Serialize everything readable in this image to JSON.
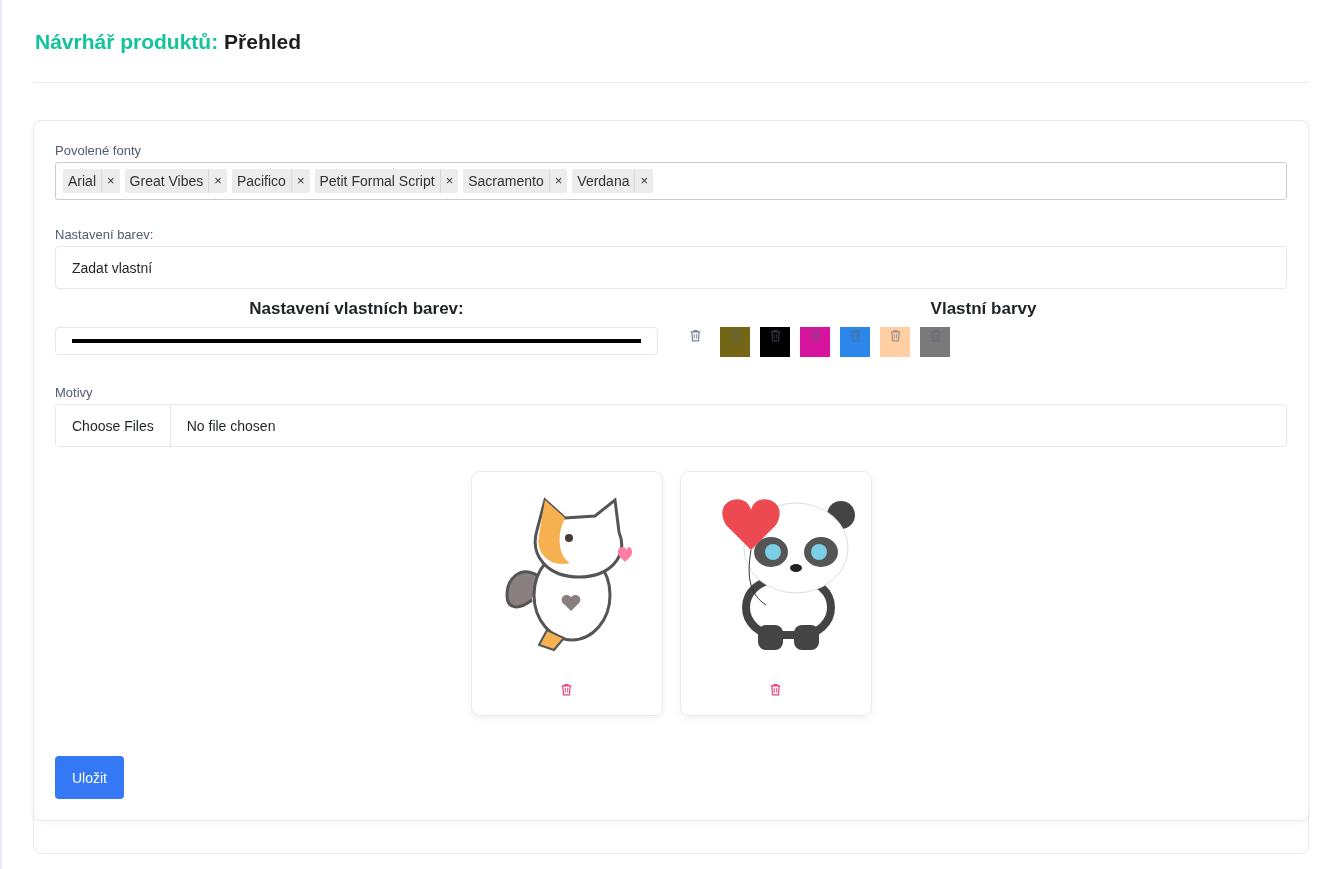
{
  "header": {
    "title_prefix": "Návrhář produktů:",
    "title": "Přehled"
  },
  "fonts": {
    "label": "Povolené fonty",
    "tags": [
      {
        "label": "Arial",
        "remove": "×"
      },
      {
        "label": "Great Vibes",
        "remove": "×"
      },
      {
        "label": "Pacifico",
        "remove": "×"
      },
      {
        "label": "Petit Formal Script",
        "remove": "×"
      },
      {
        "label": "Sacramento",
        "remove": "×"
      },
      {
        "label": "Verdana",
        "remove": "×"
      }
    ]
  },
  "color_settings": {
    "label": "Nastavení barev:",
    "value": "Zadat vlastní"
  },
  "custom_colors": {
    "picker_title": "Nastavení vlastních barev:",
    "picker": {
      "color": "#000000"
    },
    "list_title": "Vlastní barvy",
    "swatches": [
      {
        "color": "#736614"
      },
      {
        "color": "#000000"
      },
      {
        "color": "#d6149e"
      },
      {
        "color": "#2a86e8"
      },
      {
        "color": "#ffcfa3"
      },
      {
        "color": "#7a7a7a"
      }
    ]
  },
  "motifs": {
    "label": "Motivy",
    "button": "Choose Files",
    "status": "No file chosen",
    "items": [
      {
        "kind": "cat"
      },
      {
        "kind": "panda"
      }
    ]
  },
  "save_button": "Uložit"
}
